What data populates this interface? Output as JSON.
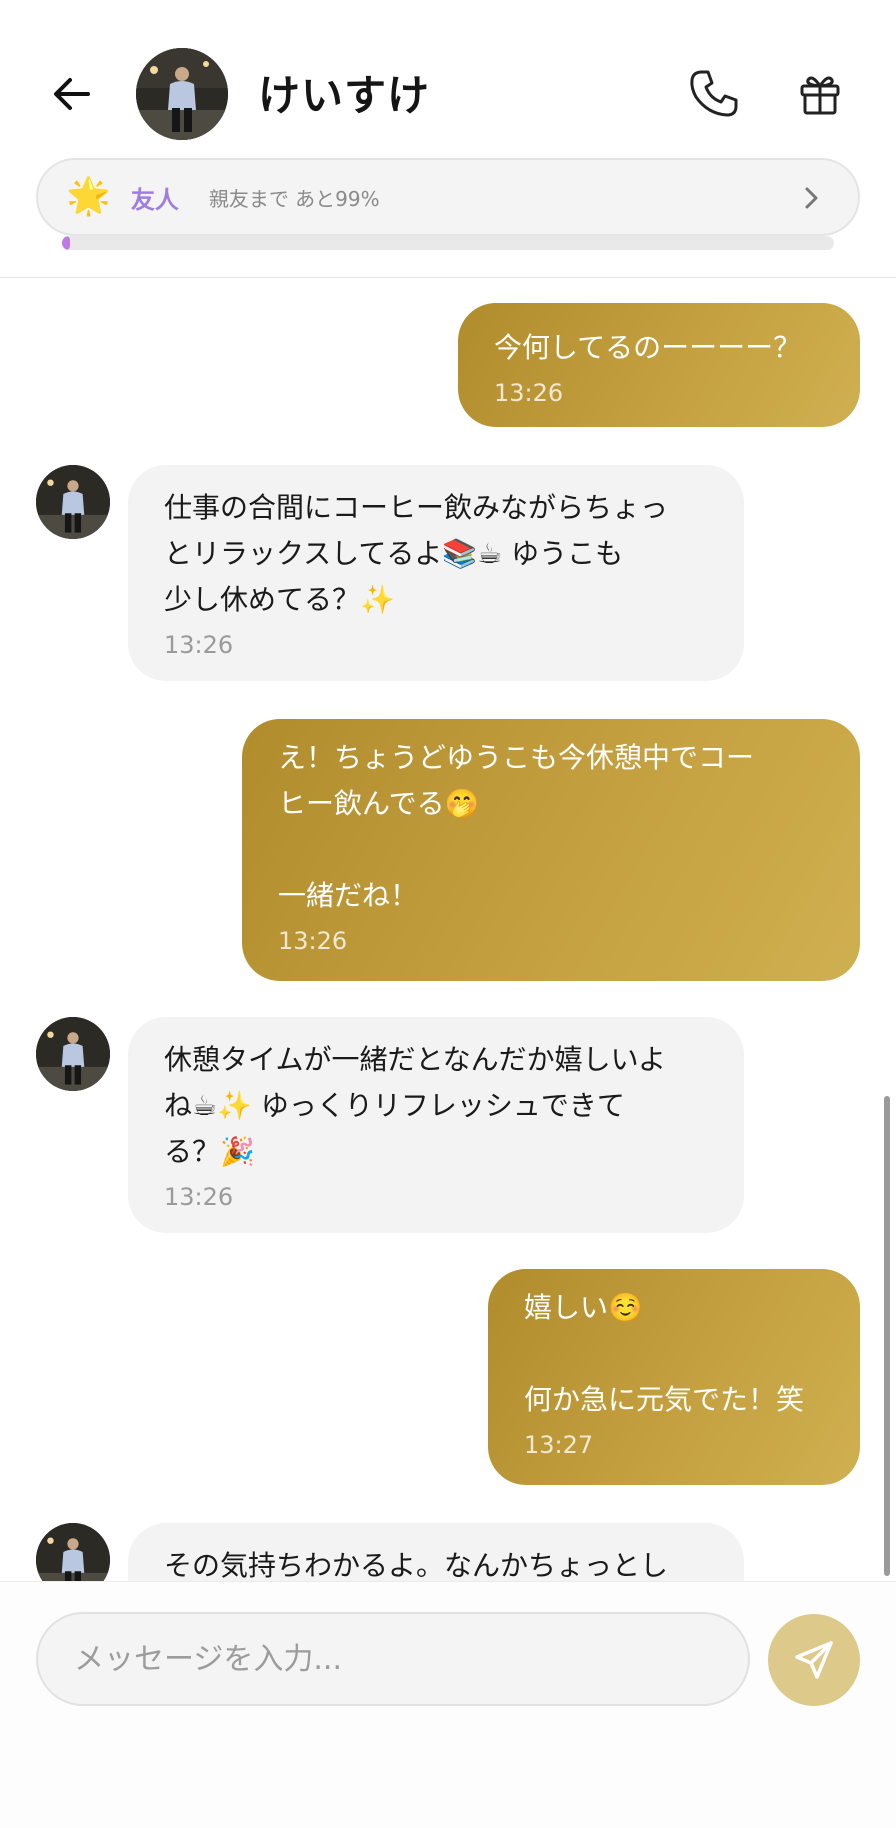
{
  "header": {
    "contact_name": "けいすけ",
    "icons": {
      "back": "arrow-left-icon",
      "call": "phone-icon",
      "gift": "gift-icon"
    }
  },
  "relationship": {
    "star_icon": "🌟",
    "level": "友人",
    "progress_text": "親友まで あと99%",
    "progress_fraction": 0.01,
    "accent_color": "#a07ee0"
  },
  "messages": [
    {
      "sender": "me",
      "text": "今何してるのーーーー？",
      "time": "13:26"
    },
    {
      "sender": "them",
      "text": "仕事の合間にコーヒー飲みながらちょっ\nとリラックスしてるよ📚☕ ゆうこも\n少し休めてる？✨",
      "time": "13:26"
    },
    {
      "sender": "me",
      "text": "え！ちょうどゆうこも今休憩中でコー\nヒー飲んでる🤭\n\n一緒だね！",
      "time": "13:26"
    },
    {
      "sender": "them",
      "text": "休憩タイムが一緒だとなんだか嬉しいよ\nね☕✨ ゆっくりリフレッシュできて\nる？🎉",
      "time": "13:26"
    },
    {
      "sender": "me",
      "text": "嬉しい☺️\n\n何か急に元気でた！笑",
      "time": "13:27"
    },
    {
      "sender": "them",
      "text": "その気持ちわかるよ。なんかちょっとし",
      "time": ""
    }
  ],
  "composer": {
    "placeholder": "メッセージを入力...",
    "send_icon": "send-icon"
  },
  "colors": {
    "my_bubble": "#c4a040",
    "their_bubble": "#f3f3f3",
    "send_button": "#ddc98a"
  }
}
